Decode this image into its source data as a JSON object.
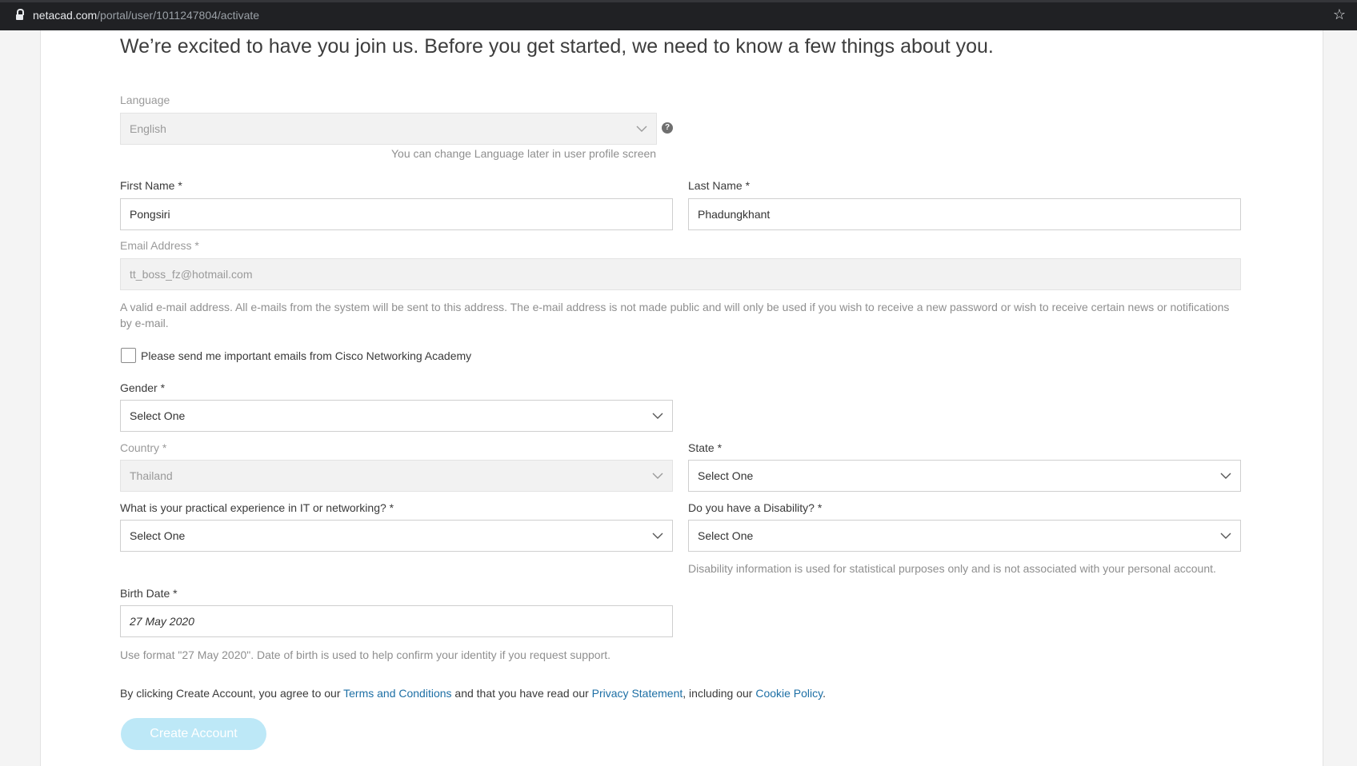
{
  "browser": {
    "url_host": "netacad.com",
    "url_path": "/portal/user/1011247804/activate"
  },
  "intro": "We’re excited to have you join us. Before you get started, we need to know a few things about you.",
  "language": {
    "label": "Language",
    "value": "English",
    "help": "You can change Language later in user profile screen"
  },
  "first_name": {
    "label": "First Name *",
    "value": "Pongsiri"
  },
  "last_name": {
    "label": "Last Name *",
    "value": "Phadungkhant"
  },
  "email": {
    "label": "Email Address *",
    "value": "tt_boss_fz@hotmail.com",
    "help_line1": "A valid e-mail address. All e-mails from the system will be sent to this address. The e-mail address is not made public and will only be used if you wish to receive a new password or wish to receive certain news or notifications",
    "help_line2": "by e-mail."
  },
  "newsletter": {
    "label": "Please send me important emails from Cisco Networking Academy",
    "checked": false
  },
  "gender": {
    "label": "Gender *",
    "value": "Select One"
  },
  "country": {
    "label": "Country *",
    "value": "Thailand"
  },
  "state": {
    "label": "State *",
    "value": "Select One"
  },
  "experience": {
    "label": "What is your practical experience in IT or networking? *",
    "value": "Select One"
  },
  "disability": {
    "label": "Do you have a Disability? *",
    "value": "Select One",
    "help": "Disability information is used for statistical purposes only and is not associated with your personal account."
  },
  "birth_date": {
    "label": "Birth Date *",
    "value": "27 May 2020",
    "help": "Use format \"27 May 2020\". Date of birth is used to help confirm your identity if you request support."
  },
  "agreement": {
    "prefix": "By clicking Create Account, you agree to our ",
    "terms": "Terms and Conditions",
    "middle": " and that you have read our ",
    "privacy": "Privacy Statement",
    "middle2": ", including our ",
    "cookie": "Cookie Policy",
    "suffix": "."
  },
  "create_button": "Create Account",
  "colors": {
    "link": "#1d6fa5",
    "button_disabled": "#bde8f7"
  },
  "icons": {
    "lock": "lock-icon",
    "star": "bookmark-star-icon",
    "help": "question-circle-icon",
    "chevron": "chevron-down-icon"
  }
}
